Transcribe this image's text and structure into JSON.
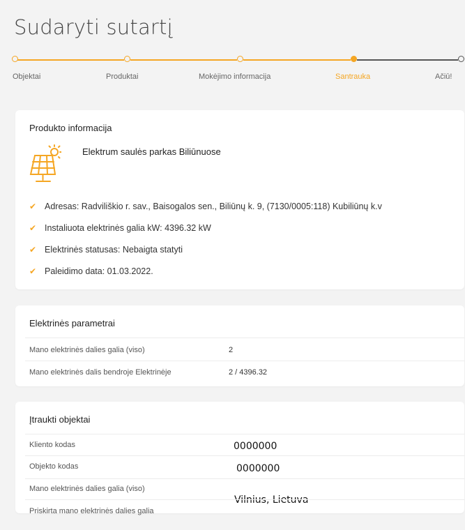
{
  "page": {
    "title": "Sudaryti sutartį"
  },
  "stepper": {
    "steps": [
      {
        "label": "Objektai",
        "state": "done"
      },
      {
        "label": "Produktai",
        "state": "done"
      },
      {
        "label": "Mokėjimo informacija",
        "state": "done"
      },
      {
        "label": "Santrauka",
        "state": "active"
      },
      {
        "label": "Ačiū!",
        "state": "upcoming"
      }
    ],
    "accent_color": "#f5a623",
    "upcoming_color": "#555555"
  },
  "product_info": {
    "title": "Produkto informacija",
    "icon": "solar-panel-icon",
    "name": "Elektrum saulės parkas Biliūnuose",
    "details": [
      "Adresas: Radviliškio r. sav., Baisogalos sen., Biliūnų k. 9, (7130/0005:118) Kubiliūnų k.v",
      "Instaliuota elektrinės galia kW: 4396.32 kW",
      "Elektrinės statusas: Nebaigta statyti",
      "Paleidimo data: 01.03.2022."
    ]
  },
  "plant_params": {
    "title": "Elektrinės parametrai",
    "rows": [
      {
        "label": "Mano elektrinės dalies galia (viso)",
        "value": "2"
      },
      {
        "label": "Mano elektrinės dalis bendroje Elektrinėje",
        "value": "2 / 4396.32"
      }
    ]
  },
  "objects": {
    "title": "Įtraukti objektai",
    "rows": [
      {
        "label": "Kliento kodas",
        "value": "0000000"
      },
      {
        "label": "Objekto kodas",
        "value": "0000000"
      },
      {
        "label": "Mano elektrinės dalies galia (viso)",
        "value": ""
      },
      {
        "label": "Priskirta mano elektrinės dalies galia",
        "value": ""
      }
    ],
    "location": "Vilnius,  Lietuva"
  }
}
